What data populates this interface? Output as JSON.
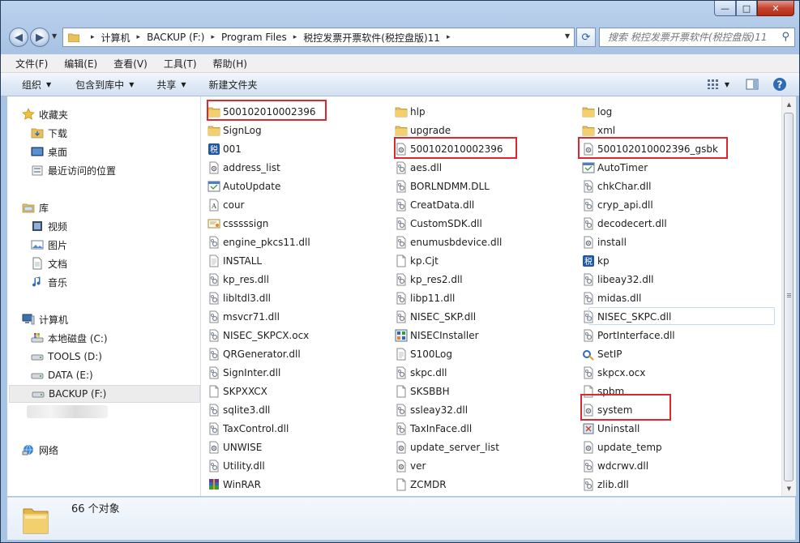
{
  "window": {
    "caption_buttons": {
      "minimize": "—",
      "maximize": "□",
      "close": "✕"
    }
  },
  "address_bar": {
    "crumbs": [
      "计算机",
      "BACKUP (F:)",
      "Program Files",
      "税控发票开票软件(税控盘版)11"
    ],
    "search_placeholder": "搜索 税控发票开票软件(税控盘版)11"
  },
  "menu": [
    "文件(F)",
    "编辑(E)",
    "查看(V)",
    "工具(T)",
    "帮助(H)"
  ],
  "toolbar": {
    "organize": "组织",
    "include_in_library": "包含到库中",
    "share": "共享",
    "new_folder": "新建文件夹"
  },
  "sidebar": {
    "favorites": "收藏夹",
    "downloads": "下载",
    "desktop": "桌面",
    "recent": "最近访问的位置",
    "libraries": "库",
    "videos": "视频",
    "pictures": "图片",
    "documents": "文档",
    "music": "音乐",
    "computer": "计算机",
    "drive_c": "本地磁盘 (C:)",
    "drive_d": "TOOLS (D:)",
    "drive_e": "DATA (E:)",
    "drive_f": "BACKUP (F:)",
    "network": "网络"
  },
  "files": {
    "col1": [
      {
        "name": "500102010002396",
        "icon": "folder"
      },
      {
        "name": "SignLog",
        "icon": "folder"
      },
      {
        "name": "001",
        "icon": "app-blue"
      },
      {
        "name": "address_list",
        "icon": "config"
      },
      {
        "name": "AutoUpdate",
        "icon": "app-window"
      },
      {
        "name": "cour",
        "icon": "font"
      },
      {
        "name": "csssssign",
        "icon": "cert"
      },
      {
        "name": "engine_pkcs11.dll",
        "icon": "dll"
      },
      {
        "name": "INSTALL",
        "icon": "text"
      },
      {
        "name": "kp_res.dll",
        "icon": "dll"
      },
      {
        "name": "libltdl3.dll",
        "icon": "dll"
      },
      {
        "name": "msvcr71.dll",
        "icon": "dll"
      },
      {
        "name": "NISEC_SKPCX.ocx",
        "icon": "dll"
      },
      {
        "name": "QRGenerator.dll",
        "icon": "dll"
      },
      {
        "name": "SignInter.dll",
        "icon": "dll"
      },
      {
        "name": "SKPXXCX",
        "icon": "blank"
      },
      {
        "name": "sqlite3.dll",
        "icon": "dll"
      },
      {
        "name": "TaxControl.dll",
        "icon": "dll"
      },
      {
        "name": "UNWISE",
        "icon": "config"
      },
      {
        "name": "Utility.dll",
        "icon": "dll"
      },
      {
        "name": "WinRAR",
        "icon": "winrar"
      }
    ],
    "col2": [
      {
        "name": "hlp",
        "icon": "folder"
      },
      {
        "name": "upgrade",
        "icon": "folder"
      },
      {
        "name": "500102010002396",
        "icon": "config"
      },
      {
        "name": "aes.dll",
        "icon": "dll"
      },
      {
        "name": "BORLNDMM.DLL",
        "icon": "dll"
      },
      {
        "name": "CreatData.dll",
        "icon": "dll"
      },
      {
        "name": "CustomSDK.dll",
        "icon": "dll"
      },
      {
        "name": "enumusbdevice.dll",
        "icon": "dll"
      },
      {
        "name": "kp.Cjt",
        "icon": "blank"
      },
      {
        "name": "kp_res2.dll",
        "icon": "dll"
      },
      {
        "name": "libp11.dll",
        "icon": "dll"
      },
      {
        "name": "NISEC_SKP.dll",
        "icon": "dll"
      },
      {
        "name": "NISECInstaller",
        "icon": "installer"
      },
      {
        "name": "S100Log",
        "icon": "text"
      },
      {
        "name": "skpc.dll",
        "icon": "dll"
      },
      {
        "name": "SKSBBH",
        "icon": "blank"
      },
      {
        "name": "ssleay32.dll",
        "icon": "dll"
      },
      {
        "name": "TaxInFace.dll",
        "icon": "dll"
      },
      {
        "name": "update_server_list",
        "icon": "config"
      },
      {
        "name": "ver",
        "icon": "config"
      },
      {
        "name": "ZCMDR",
        "icon": "blank"
      }
    ],
    "col3": [
      {
        "name": "log",
        "icon": "folder"
      },
      {
        "name": "xml",
        "icon": "folder"
      },
      {
        "name": "500102010002396_gsbk",
        "icon": "config"
      },
      {
        "name": "AutoTimer",
        "icon": "app-window"
      },
      {
        "name": "chkChar.dll",
        "icon": "dll"
      },
      {
        "name": "cryp_api.dll",
        "icon": "dll"
      },
      {
        "name": "decodecert.dll",
        "icon": "dll"
      },
      {
        "name": "install",
        "icon": "config"
      },
      {
        "name": "kp",
        "icon": "app-blue"
      },
      {
        "name": "libeay32.dll",
        "icon": "dll"
      },
      {
        "name": "midas.dll",
        "icon": "dll"
      },
      {
        "name": "NISEC_SKPC.dll",
        "icon": "dll"
      },
      {
        "name": "PortInterface.dll",
        "icon": "dll"
      },
      {
        "name": "SetIP",
        "icon": "setip"
      },
      {
        "name": "skpcx.ocx",
        "icon": "dll"
      },
      {
        "name": "spbm",
        "icon": "blank"
      },
      {
        "name": "system",
        "icon": "config"
      },
      {
        "name": "Uninstall",
        "icon": "uninstall"
      },
      {
        "name": "update_temp",
        "icon": "config"
      },
      {
        "name": "wdcrwv.dll",
        "icon": "dll"
      },
      {
        "name": "zlib.dll",
        "icon": "dll"
      }
    ]
  },
  "status": {
    "count": "66 个对象"
  },
  "colors": {
    "highlight": "#e0262e",
    "folder": "#e8c15a",
    "accent": "#2f6bb5"
  }
}
